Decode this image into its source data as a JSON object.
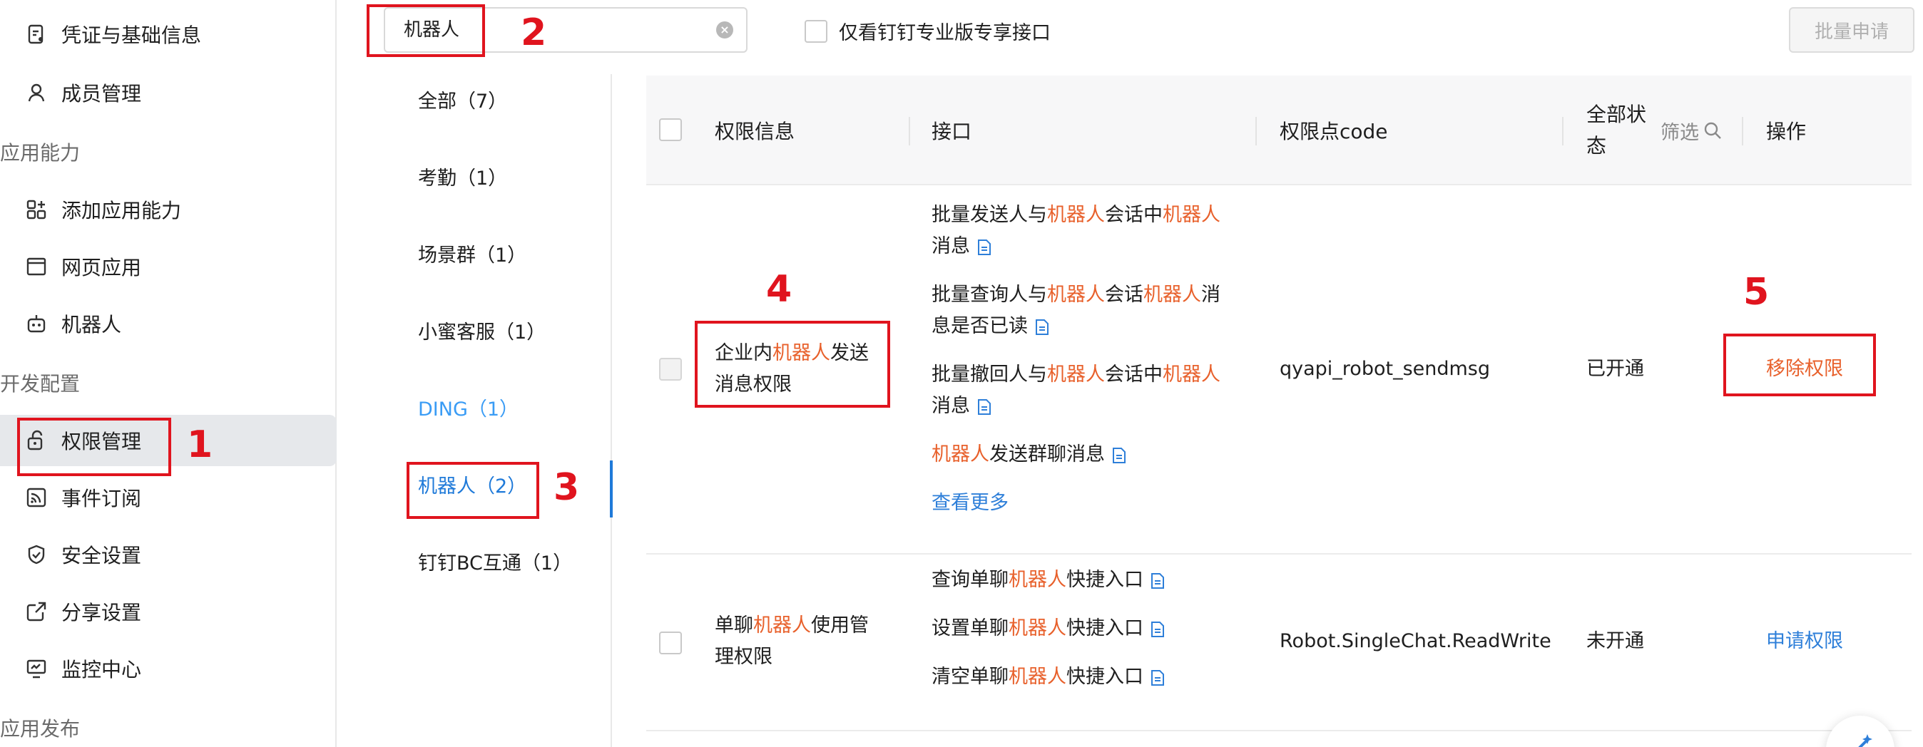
{
  "sidebar": {
    "items_top": [
      {
        "label": "凭证与基础信息",
        "icon": "credential-icon"
      },
      {
        "label": "成员管理",
        "icon": "member-icon"
      }
    ],
    "group_app_ability": "应用能力",
    "items_ability": [
      {
        "label": "添加应用能力",
        "icon": "add-ability-icon"
      },
      {
        "label": "网页应用",
        "icon": "web-app-icon"
      },
      {
        "label": "机器人",
        "icon": "robot-icon"
      }
    ],
    "group_dev_config": "开发配置",
    "items_dev": [
      {
        "label": "权限管理",
        "icon": "permission-icon",
        "active": true
      },
      {
        "label": "事件订阅",
        "icon": "event-icon"
      },
      {
        "label": "安全设置",
        "icon": "shield-icon"
      },
      {
        "label": "分享设置",
        "icon": "share-icon"
      },
      {
        "label": "监控中心",
        "icon": "monitor-icon"
      }
    ],
    "group_publish": "应用发布"
  },
  "toolbar": {
    "search_value": "机器人",
    "only_pro_label": "仅看钉钉专业版专享接口",
    "batch_apply_label": "批量申请"
  },
  "categories": [
    {
      "label": "全部（7）"
    },
    {
      "label": "考勤（1）"
    },
    {
      "label": "场景群（1）"
    },
    {
      "label": "小蜜客服（1）"
    },
    {
      "label": "DING（1）"
    },
    {
      "label": "机器人（2）",
      "selected": true
    },
    {
      "label": "钉钉BC互通（1）"
    }
  ],
  "table": {
    "headers": {
      "permission_info": "权限信息",
      "api": "接口",
      "code": "权限点code",
      "status_line1": "全部状",
      "status_line2": "态",
      "filter": "筛选",
      "action": "操作"
    },
    "rows": [
      {
        "perm_a": "企业内",
        "perm_hl": "机器人",
        "perm_b": "发送",
        "perm_line2": "消息权限",
        "apis": {
          "a1_p1": "批量发送人与",
          "a1_h1": "机器人",
          "a1_p2": "会话中",
          "a1_h2": "机器人",
          "a1_line2": "消息",
          "a2_p1": "批量查询人与",
          "a2_h1": "机器人",
          "a2_p2": "会话",
          "a2_h2": "机器人",
          "a2_p3": "消",
          "a2_line2": "息是否已读",
          "a3_p1": "批量撤回人与",
          "a3_h1": "机器人",
          "a3_p2": "会话中",
          "a3_h2": "机器人",
          "a3_line2": "消息",
          "a4_h1": "机器人",
          "a4_p1": "发送群聊消息",
          "more": "查看更多"
        },
        "code": "qyapi_robot_sendmsg",
        "status": "已开通",
        "action": "移除权限"
      },
      {
        "perm_a": "单聊",
        "perm_hl": "机器人",
        "perm_b": "使用管",
        "perm_line2": "理权限",
        "apis": {
          "b1_p1": "查询单聊",
          "b1_h1": "机器人",
          "b1_p2": "快捷入口",
          "b2_p1": "设置单聊",
          "b2_h1": "机器人",
          "b2_p2": "快捷入口",
          "b3_p1": "清空单聊",
          "b3_h1": "机器人",
          "b3_p2": "快捷入口"
        },
        "code": "Robot.SingleChat.ReadWrite",
        "status": "未开通",
        "action": "申请权限"
      }
    ]
  },
  "annotations": {
    "n1": "1",
    "n2": "2",
    "n3": "3",
    "n4": "4",
    "n5": "5",
    "color": "#e0141e"
  },
  "colors": {
    "highlight": "#e8612c",
    "link": "#2e7fd9",
    "selected_category": "#1f7ad9"
  }
}
